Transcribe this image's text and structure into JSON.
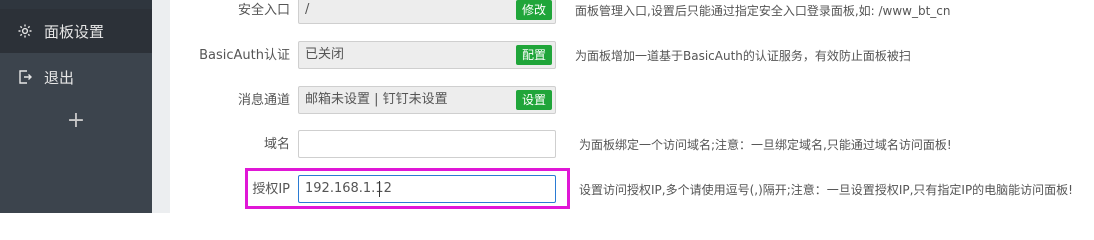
{
  "sidebar": {
    "items": [
      {
        "label": "面板设置",
        "icon": "gear-icon"
      },
      {
        "label": "退出",
        "icon": "logout-icon"
      }
    ],
    "add_label": "+"
  },
  "settings": {
    "safe_entry": {
      "label": "安全入口",
      "value": "/",
      "button": "修改",
      "hint": "面板管理入口,设置后只能通过指定安全入口登录面板,如: /www_bt_cn"
    },
    "basic_auth": {
      "label": "BasicAuth认证",
      "value": "已关闭",
      "button": "配置",
      "hint": "为面板增加一道基于BasicAuth的认证服务，有效防止面板被扫"
    },
    "message_channel": {
      "label": "消息通道",
      "value": "邮箱未设置 | 钉钉未设置",
      "button": "设置",
      "hint": ""
    },
    "domain": {
      "label": "域名",
      "value": "",
      "hint": "为面板绑定一个访问域名;注意：一旦绑定域名,只能通过域名访问面板!"
    },
    "authorized_ip": {
      "label": "授权IP",
      "value": "192.168.1.12",
      "hint": "设置访问授权IP,多个请使用逗号(,)隔开;注意：一旦设置授权IP,只有指定IP的电脑能访问面板!"
    }
  },
  "colors": {
    "accent": "#20a53a",
    "highlight": "#e017d6",
    "sidebar": "#3c444d"
  }
}
